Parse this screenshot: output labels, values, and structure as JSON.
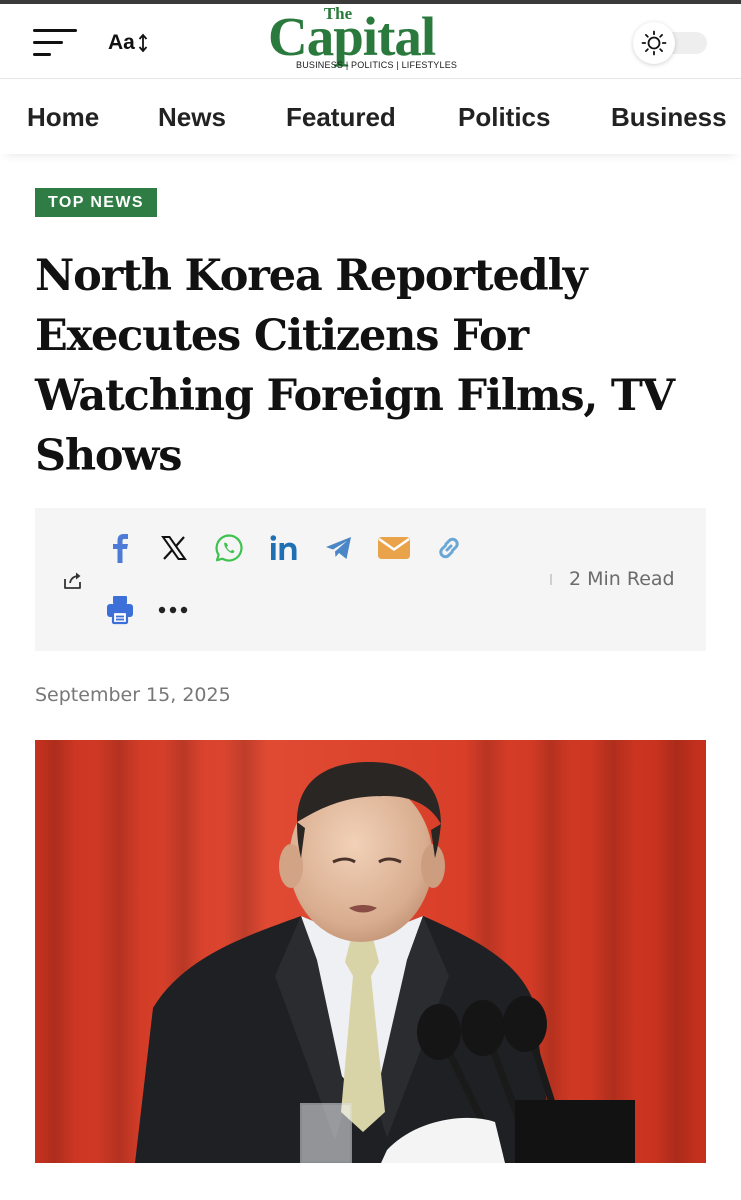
{
  "header": {
    "font_size_label": "Aa",
    "logo": {
      "the": "The",
      "name": "Capital",
      "tagline": "BUSINESS | POLITICS | LIFESTYLES"
    }
  },
  "nav": {
    "items": [
      {
        "label": "Home"
      },
      {
        "label": "News"
      },
      {
        "label": "Featured"
      },
      {
        "label": "Politics"
      },
      {
        "label": "Business"
      }
    ]
  },
  "article": {
    "category": "TOP NEWS",
    "title": "North Korea Reportedly Executes Citizens For Watching Foreign Films, TV Shows",
    "read_time": "2 Min Read",
    "date": "September 15, 2025"
  },
  "share": {
    "icons": [
      "facebook-icon",
      "x-icon",
      "whatsapp-icon",
      "linkedin-icon",
      "telegram-icon",
      "email-icon",
      "copy-link-icon",
      "print-icon",
      "more-icon"
    ]
  },
  "colors": {
    "brand_green": "#2b7a3d",
    "badge_green": "#2f7d44",
    "facebook": "#4d7bd6",
    "whatsapp": "#3fc24f",
    "linkedin": "#1f6fb5",
    "telegram": "#4b86c6",
    "email": "#e9a34a",
    "link": "#6aa7d4",
    "print": "#3d6fd8",
    "hero_background": "#d9402c"
  }
}
